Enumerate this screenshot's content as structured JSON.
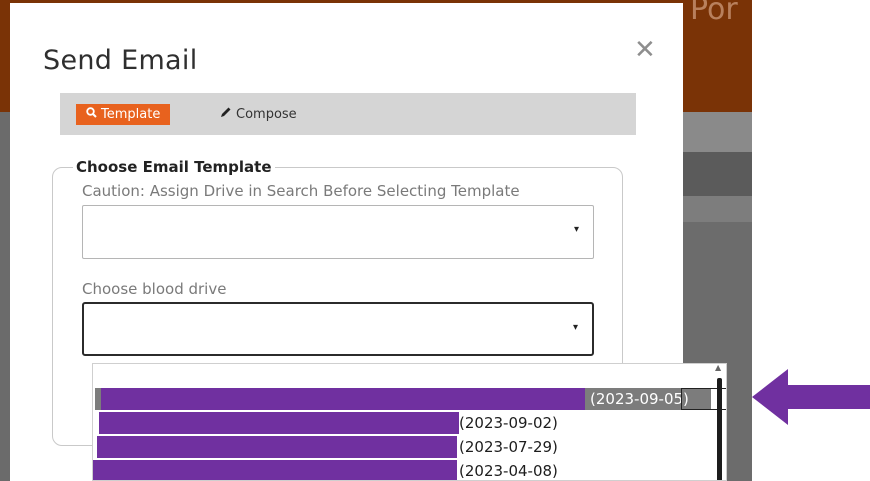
{
  "background": {
    "title_fragment": "Por"
  },
  "modal": {
    "title": "Send Email",
    "close_symbol": "✕",
    "tabs": [
      {
        "label": "Template",
        "icon": "search-icon",
        "active": true
      },
      {
        "label": "Compose",
        "icon": "pencil-icon",
        "active": false
      }
    ],
    "fieldset_legend": "Choose Email Template",
    "caution_text": "Caution: Assign Drive in Search Before Selecting Template",
    "template_select": {
      "value": "",
      "caret": "▾"
    },
    "drive_label": "Choose blood drive",
    "drive_select": {
      "value": "",
      "caret": "▾"
    }
  },
  "dropdown": {
    "options": [
      {
        "date": "(2023-09-05)",
        "selected": true
      },
      {
        "date": "(2023-09-02)",
        "selected": false
      },
      {
        "date": "(2023-07-29)",
        "selected": false
      },
      {
        "date": "(2023-04-08)",
        "selected": false
      }
    ]
  },
  "colors": {
    "accent": "#e8621e",
    "header": "#7a3306",
    "redaction": "#7030a0",
    "arrow": "#7030a0"
  }
}
